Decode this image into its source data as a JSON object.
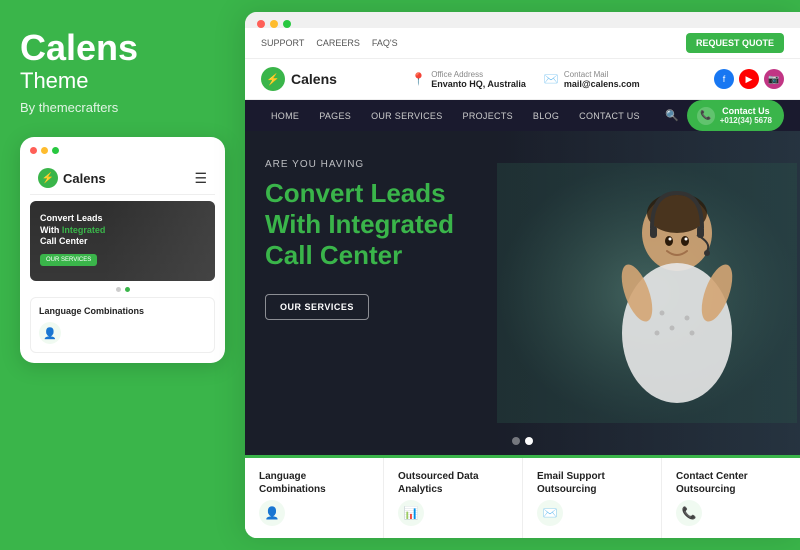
{
  "brand": {
    "name": "Calens",
    "subtitle": "Theme",
    "by": "By themecrafters"
  },
  "browser": {
    "dots": [
      "red",
      "yellow",
      "green"
    ]
  },
  "website": {
    "topbar": {
      "links": [
        "SUPPORT",
        "CAREERS",
        "FAQ'S"
      ],
      "cta": "REQUEST QUOTE"
    },
    "header": {
      "logo": "Calens",
      "office_label": "Office Address",
      "office_value": "Envanto HQ, Australia",
      "contact_label": "Contact Mail",
      "contact_value": "mail@calens.com"
    },
    "nav": {
      "links": [
        "HOME",
        "PAGES",
        "OUR SERVICES",
        "PROJECTS",
        "BLOG",
        "CONTACT US"
      ],
      "cta_label": "Contact Us",
      "cta_phone": "+012(34) 5678"
    },
    "hero": {
      "subtitle": "ARE YOU HAVING",
      "title_line1": "Convert Leads",
      "title_line2": "With ",
      "title_highlight": "Integrated",
      "title_line3": "Call Center",
      "cta": "OUR SERVICES"
    },
    "service_cards": [
      {
        "title": "Language\nCombinations",
        "icon": "👤"
      },
      {
        "title": "Outsourced Data\nAnalytics",
        "icon": "📊"
      },
      {
        "title": "Email Support\nOutsourcing",
        "icon": "✉️"
      },
      {
        "title": "Contact Center\nOutsourcing",
        "icon": "📞"
      }
    ]
  },
  "mobile_mockup": {
    "logo": "Calens",
    "hero_subtitle": "Convert Leads",
    "hero_title_main": "Convert Leads",
    "hero_title_with": "With ",
    "hero_title_highlight": "Integrated",
    "hero_title_end": "Call Center",
    "hero_btn": "OUR SERVICES",
    "card_title": "Language Combinations"
  }
}
